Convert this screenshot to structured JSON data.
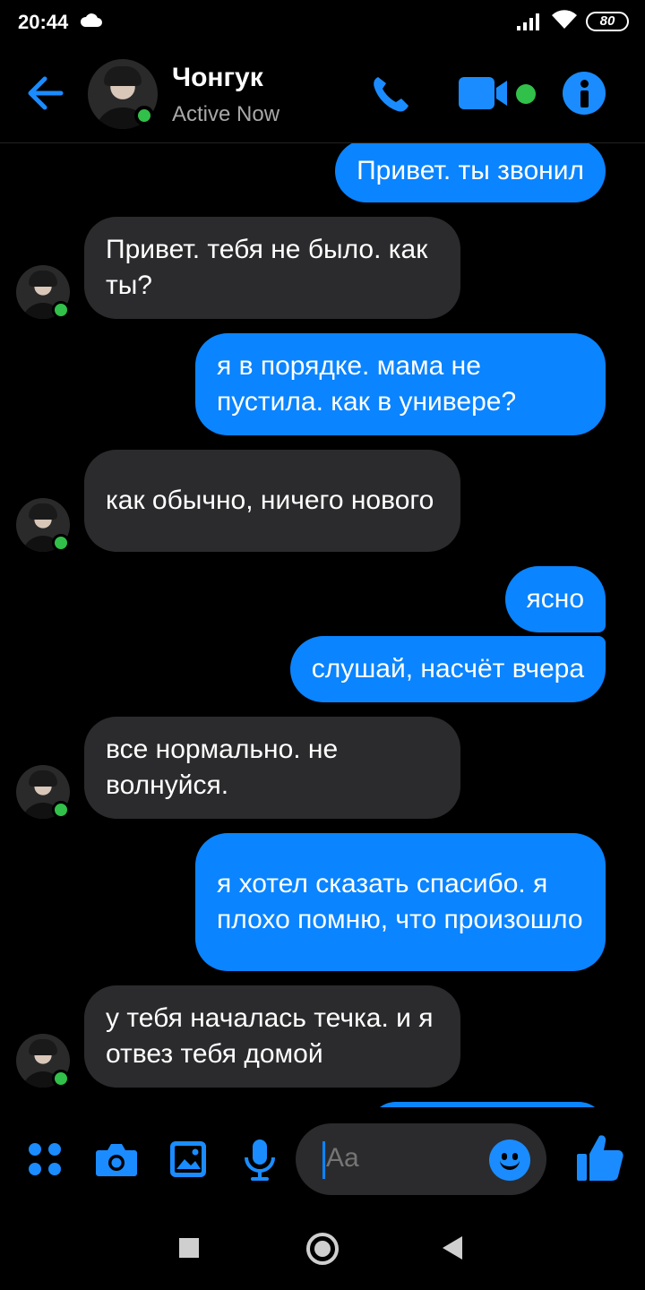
{
  "status_bar": {
    "time": "20:44",
    "battery": "80"
  },
  "header": {
    "contact_name": "Чонгук",
    "contact_status": "Active Now"
  },
  "messages": [
    {
      "from": "me",
      "text": "Привет. ты звонил"
    },
    {
      "from": "them",
      "text": "Привет. тебя не было. как ты?"
    },
    {
      "from": "me",
      "text": "я в порядке. мама не пустила. как в универе?"
    },
    {
      "from": "them",
      "text": "как обычно, ничего нового"
    },
    {
      "from": "me",
      "text": "ясно"
    },
    {
      "from": "me",
      "text": "слушай, насчёт вчера"
    },
    {
      "from": "them",
      "text": "все нормально. не волнуйся."
    },
    {
      "from": "me",
      "text": "я хотел сказать спасибо. я плохо помню, что произошло"
    },
    {
      "from": "them",
      "text": "у тебя началась течка. и я отвез тебя домой"
    }
  ],
  "composer": {
    "placeholder": "Aa"
  },
  "colors": {
    "accent": "#0a84ff",
    "incoming_bubble": "#2b2b2d",
    "online": "#31c04a",
    "background": "#000000"
  },
  "icons": {
    "back": "arrow-left-icon",
    "call": "phone-icon",
    "video": "video-camera-icon",
    "info": "info-icon",
    "apps": "four-dots-icon",
    "camera": "camera-icon",
    "gallery": "image-icon",
    "mic": "microphone-icon",
    "emoji": "smiley-icon",
    "like": "thumbs-up-icon"
  }
}
